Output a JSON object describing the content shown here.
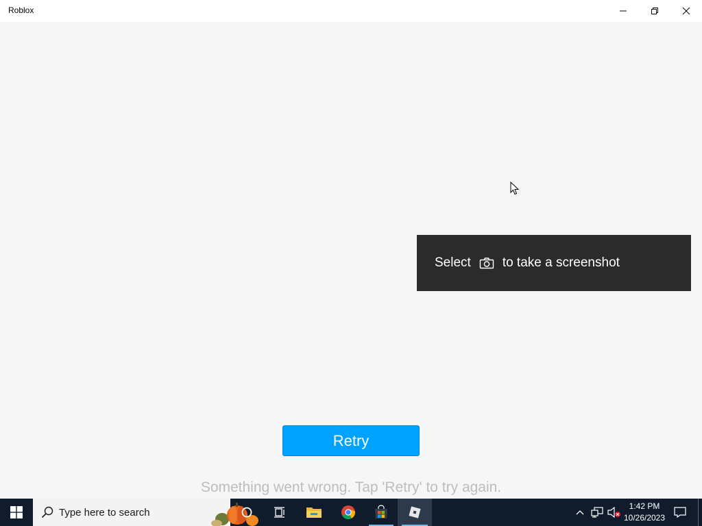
{
  "window": {
    "title": "Roblox"
  },
  "toast": {
    "text_before": "Select",
    "icon": "camera-icon",
    "text_after": "to take a screenshot"
  },
  "retry": {
    "label": "Retry"
  },
  "error": {
    "message": "Something went wrong. Tap 'Retry' to try again."
  },
  "taskbar": {
    "search_placeholder": "Type here to search",
    "apps": [
      "cortana-icon",
      "task-view-icon",
      "file-explorer-icon",
      "chrome-icon",
      "microsoft-store-icon",
      "roblox-icon"
    ],
    "active_app": "Roblox",
    "clock": {
      "time": "1:42 PM",
      "date": "10/26/2023"
    }
  },
  "colors": {
    "retry_bg": "#00a2ff",
    "toast_bg": "#2b2b2b",
    "taskbar_bg": "#101c2c",
    "page_bg": "#f6f6f6"
  }
}
